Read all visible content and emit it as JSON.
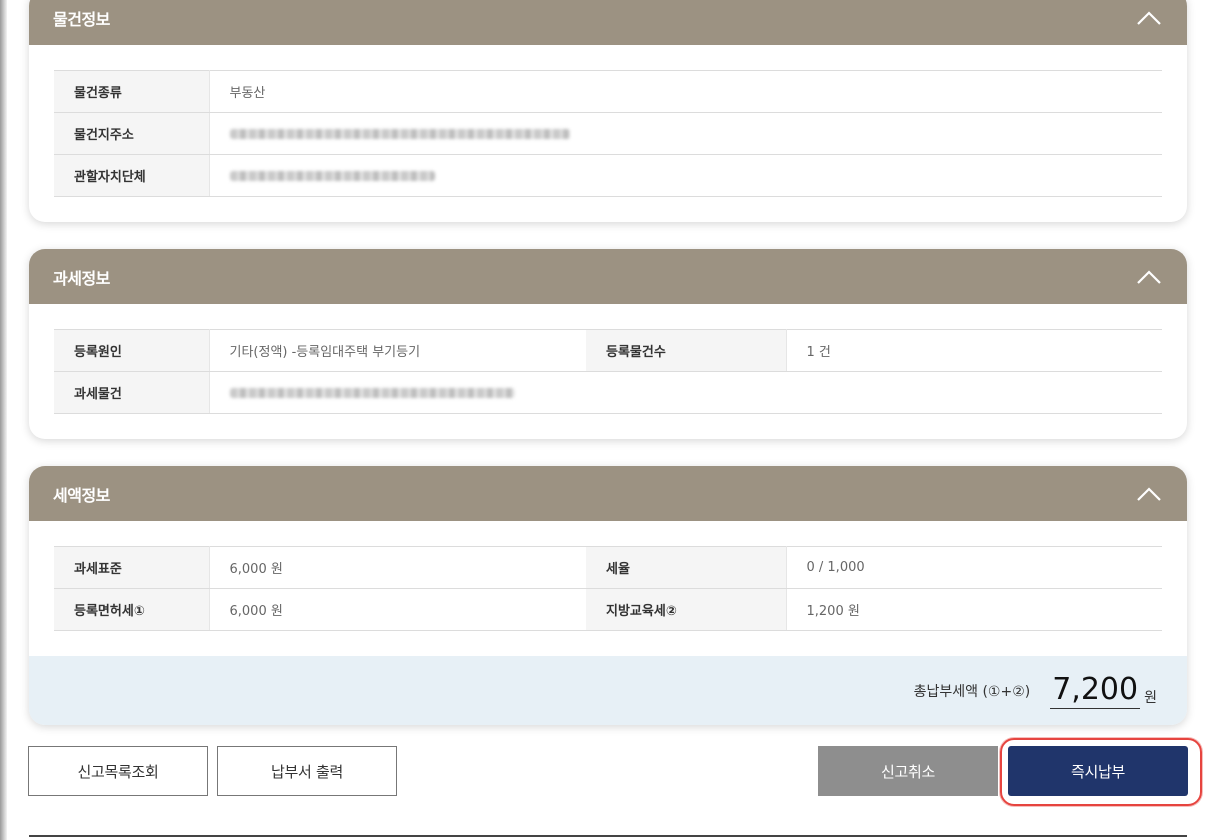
{
  "sections": {
    "property": {
      "title": "물건정보",
      "rows": [
        {
          "label": "물건종류",
          "value": "부동산"
        },
        {
          "label": "물건지주소",
          "value": ""
        },
        {
          "label": "관할자치단체",
          "value": ""
        }
      ]
    },
    "taxation": {
      "title": "과세정보",
      "reg_cause_label": "등록원인",
      "reg_cause_value": "기타(정액) -등록임대주택 부기등기",
      "reg_count_label": "등록물건수",
      "reg_count_value": "1 건",
      "tax_object_label": "과세물건",
      "tax_object_value": ""
    },
    "amount": {
      "title": "세액정보",
      "base_label": "과세표준",
      "base_value": "6,000 원",
      "rate_label": "세율",
      "rate_value": "0 / 1,000",
      "license_tax_label": "등록면허세①",
      "license_tax_value": "6,000 원",
      "edu_tax_label": "지방교육세②",
      "edu_tax_value": "1,200 원",
      "total_label": "총납부세액 (①+②)",
      "total_amount": "7,200",
      "total_unit": "원"
    }
  },
  "buttons": {
    "report_list": "신고목록조회",
    "print_bill": "납부서 출력",
    "cancel_report": "신고취소",
    "pay_now": "즉시납부"
  },
  "colors": {
    "header_bg": "#9c9282",
    "pay_button": "#20356b",
    "cancel_button": "#8e8e8e",
    "total_bar": "#e7f0f6",
    "highlight": "#e6443f"
  },
  "icons": {
    "collapse": "chevron-up-icon"
  }
}
